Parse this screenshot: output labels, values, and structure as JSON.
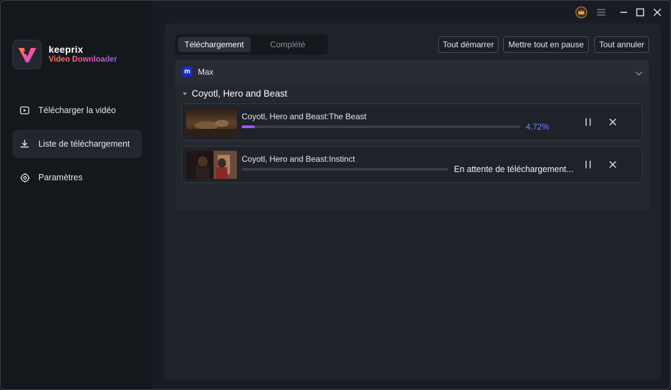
{
  "app": {
    "name": "keeprix",
    "subtitle": "Video Downloader"
  },
  "sidebar": {
    "items": [
      {
        "label": "Télécharger la vidéo",
        "icon": "play-icon",
        "active": false
      },
      {
        "label": "Liste de téléchargement",
        "icon": "download-icon",
        "active": true
      },
      {
        "label": "Paramètres",
        "icon": "gear-icon",
        "active": false
      }
    ]
  },
  "titlebar": {
    "icons": [
      "crown-icon",
      "menu-icon",
      "minimize-icon",
      "maximize-icon",
      "close-icon"
    ]
  },
  "tabs": [
    {
      "label": "Téléchargement",
      "active": true
    },
    {
      "label": "Complété",
      "active": false
    }
  ],
  "actions": {
    "start_all": "Tout démarrer",
    "pause_all": "Mettre tout en pause",
    "cancel_all": "Tout annuler"
  },
  "group": {
    "service": "Max",
    "badge": "m",
    "series": "Coyotl, Hero and Beast",
    "items": [
      {
        "title": "Coyotl, Hero and Beast:The Beast",
        "progress_percent": 4.72,
        "status": "4.72%"
      },
      {
        "title": "Coyotl, Hero and Beast:Instinct",
        "progress_percent": 0,
        "status": "En attente de téléchargement..."
      }
    ]
  },
  "colors": {
    "accent": "#6b8cff",
    "progress_start": "#c24bff",
    "progress_end": "#7c5cff",
    "max_brand": "#1a2cc4"
  }
}
